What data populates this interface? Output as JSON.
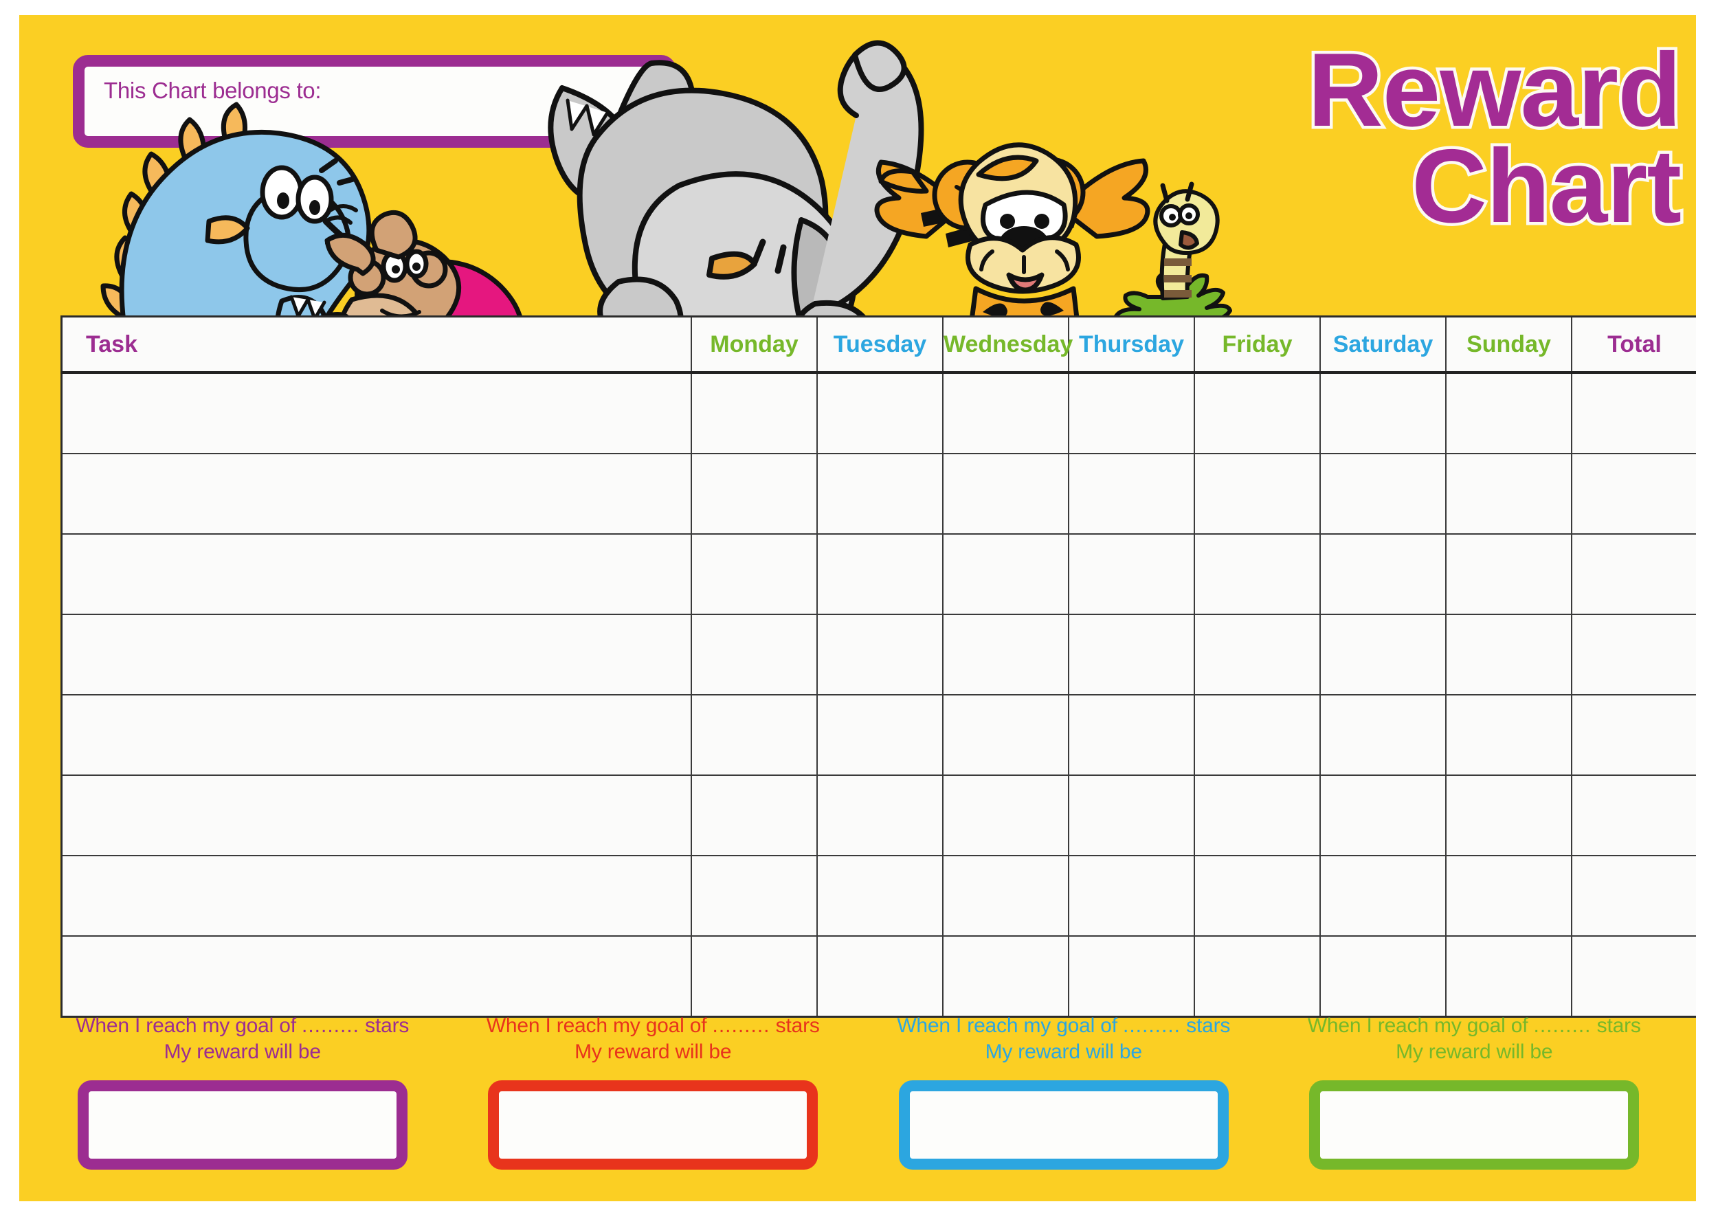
{
  "poster": {
    "background_color": "#fbcf23",
    "title_lines": [
      "Reward",
      "Chart"
    ],
    "title_color": "#a32c94",
    "title_outline_color": "#fdfaf2"
  },
  "name_box": {
    "label": "This Chart belongs to:",
    "value": "",
    "border_color": "#9c2d91"
  },
  "table": {
    "columns": [
      {
        "label": "Task",
        "color": "#9c2d91",
        "kind": "task"
      },
      {
        "label": "Monday",
        "color": "#76b82a",
        "kind": "day"
      },
      {
        "label": "Tuesday",
        "color": "#2ca6e0",
        "kind": "day"
      },
      {
        "label": "Wednesday",
        "color": "#76b82a",
        "kind": "day"
      },
      {
        "label": "Thursday",
        "color": "#2ca6e0",
        "kind": "day"
      },
      {
        "label": "Friday",
        "color": "#76b82a",
        "kind": "day"
      },
      {
        "label": "Saturday",
        "color": "#2ca6e0",
        "kind": "day"
      },
      {
        "label": "Sunday",
        "color": "#76b82a",
        "kind": "day"
      },
      {
        "label": "Total",
        "color": "#9c2d91",
        "kind": "total"
      }
    ],
    "row_count": 8,
    "rows": [
      [
        "",
        "",
        "",
        "",
        "",
        "",
        "",
        "",
        ""
      ],
      [
        "",
        "",
        "",
        "",
        "",
        "",
        "",
        "",
        ""
      ],
      [
        "",
        "",
        "",
        "",
        "",
        "",
        "",
        "",
        ""
      ],
      [
        "",
        "",
        "",
        "",
        "",
        "",
        "",
        "",
        ""
      ],
      [
        "",
        "",
        "",
        "",
        "",
        "",
        "",
        "",
        ""
      ],
      [
        "",
        "",
        "",
        "",
        "",
        "",
        "",
        "",
        ""
      ],
      [
        "",
        "",
        "",
        "",
        "",
        "",
        "",
        "",
        ""
      ],
      [
        "",
        "",
        "",
        "",
        "",
        "",
        "",
        "",
        ""
      ]
    ]
  },
  "rewards": [
    {
      "line1_prefix": "When I reach my goal of ",
      "line1_dots": ".........",
      "line1_suffix": " stars",
      "line2": "My reward will be",
      "value": "",
      "color": "#9c2d91"
    },
    {
      "line1_prefix": "When I reach my goal of ",
      "line1_dots": ".........",
      "line1_suffix": " stars",
      "line2": "My reward will be",
      "value": "",
      "color": "#e8341c"
    },
    {
      "line1_prefix": "When I reach my goal of ",
      "line1_dots": ".........",
      "line1_suffix": " stars",
      "line2": "My reward will be",
      "value": "",
      "color": "#2ca6e0"
    },
    {
      "line1_prefix": "When I reach my goal of ",
      "line1_dots": ".........",
      "line1_suffix": " stars",
      "line2": "My reward will be",
      "value": "",
      "color": "#76b82a"
    }
  ],
  "characters": [
    {
      "name": "dinosaur",
      "colors": [
        "#8ec7ea",
        "#f5b553"
      ]
    },
    {
      "name": "monkey",
      "colors": [
        "#d9a87a",
        "#e5177f"
      ]
    },
    {
      "name": "elephant",
      "colors": [
        "#c9c9c9",
        "#e8a33d"
      ]
    },
    {
      "name": "tiger",
      "colors": [
        "#f5a623",
        "#f7e3a1"
      ]
    },
    {
      "name": "worm",
      "colors": [
        "#f2ea9a",
        "#76b82a"
      ]
    }
  ]
}
